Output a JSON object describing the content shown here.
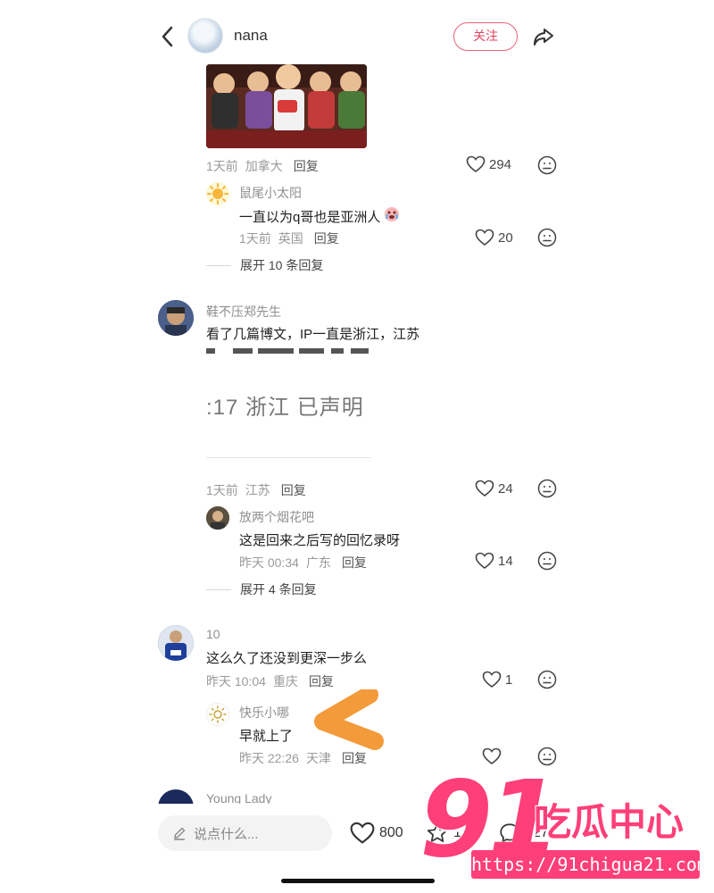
{
  "header": {
    "username": "nana",
    "follow_label": "关注"
  },
  "comments": [
    {
      "meta": {
        "time": "1天前",
        "location": "加拿大",
        "reply": "回复",
        "likes": "294"
      },
      "replies": [
        {
          "name": "鼠尾小太阳",
          "text": "一直以为q哥也是亚洲人",
          "time": "1天前",
          "location": "英国",
          "reply": "回复",
          "likes": "20"
        }
      ],
      "expand": "展开 10 条回复"
    },
    {
      "name": "鞋不压郑先生",
      "text": "看了几篇博文，IP一直是浙江，江苏",
      "image_text": ":17 浙江  已声明",
      "meta": {
        "time": "1天前",
        "location": "江苏",
        "reply": "回复",
        "likes": "24"
      },
      "replies": [
        {
          "name": "放两个烟花吧",
          "text": "这是回来之后写的回忆录呀",
          "time": "昨天 00:34",
          "location": "广东",
          "reply": "回复",
          "likes": "14"
        }
      ],
      "expand": "展开 4 条回复"
    },
    {
      "name": "10",
      "text": "这么久了还没到更深一步么",
      "meta": {
        "time": "昨天 10:04",
        "location": "重庆",
        "reply": "回复",
        "likes": "1"
      },
      "replies": [
        {
          "name": "快乐小哪",
          "text": "早就上了",
          "time": "昨天 22:26",
          "location": "天津",
          "reply": "回复",
          "likes": ""
        }
      ]
    },
    {
      "name": "Young Lady"
    }
  ],
  "bottom_bar": {
    "input_placeholder": "说点什么...",
    "likes": "800",
    "collects": "126",
    "comments": "227"
  },
  "watermark": {
    "number": "91",
    "text": "吃瓜中心",
    "url": "https://91chigua21.com"
  },
  "colors": {
    "accent": "#e0455f",
    "watermark": "#ff3f79",
    "arrow": "#f39a3a"
  }
}
